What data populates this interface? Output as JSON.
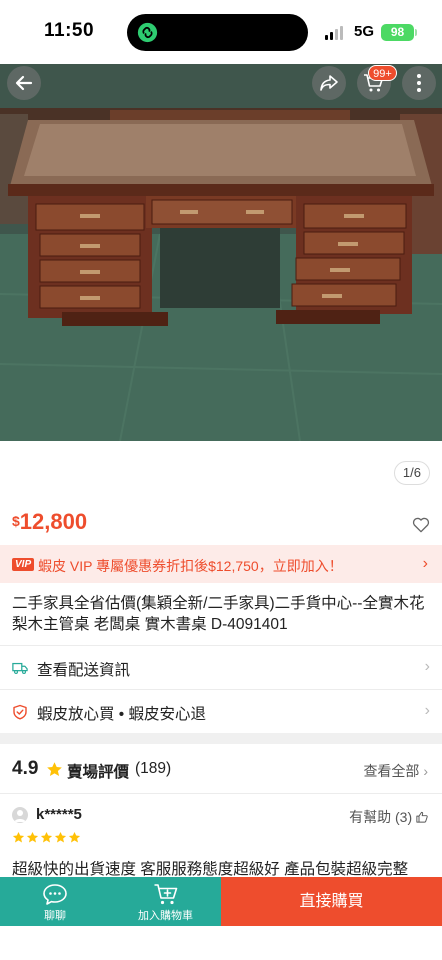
{
  "status_bar": {
    "time": "11:50",
    "network": "5G",
    "battery": "98"
  },
  "header": {
    "cart_badge": "99+"
  },
  "gallery": {
    "counter": "1/6"
  },
  "price": {
    "currency": "$",
    "value": "12,800"
  },
  "vip": {
    "badge": "VIP",
    "text": "蝦皮 VIP 專屬優惠券折扣後$12,750，立即加入！"
  },
  "product": {
    "title": "二手家具全省估價(集穎全新/二手家具)二手貨中心--全實木花梨木主管桌 老闆桌 實木書桌 D-4091401"
  },
  "shipping": {
    "label": "查看配送資訊"
  },
  "guarantee": {
    "label": "蝦皮放心買 • 蝦皮安心退"
  },
  "rating": {
    "score": "4.9",
    "label": "賣場評價",
    "count": "(189)",
    "see_all": "查看全部"
  },
  "review": {
    "username": "k*****5",
    "helpful": "有幫助 (3)",
    "stars": 5,
    "text": "超級快的出貨速度  客服服務態度超級好  產品包裝超級完整"
  },
  "bottom_bar": {
    "chat_label": "聊聊",
    "add_to_cart_label": "加入購物車",
    "buy_now_label": "直接購買"
  },
  "colors": {
    "brand": "#ee4d2d",
    "teal": "#26aa99",
    "vip_bg": "#fdebe8",
    "star": "#ffc107"
  }
}
